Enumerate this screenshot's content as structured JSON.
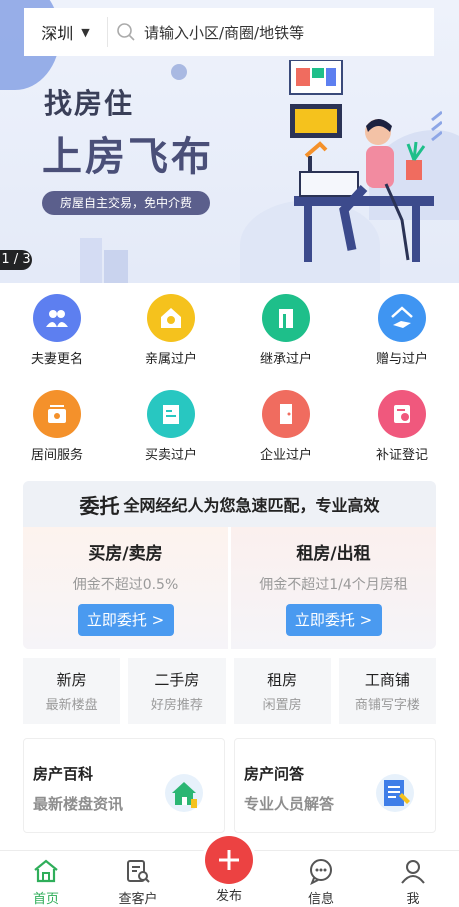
{
  "search": {
    "city": "深圳",
    "placeholder": "请输入小区/商圈/地铁等"
  },
  "banner": {
    "title_line1": "找房住",
    "title_line2": "上房飞布",
    "pill": "房屋自主交易，免中介费",
    "counter": "1 / 3"
  },
  "services": [
    {
      "label": "夫妻更名",
      "icon": "couple-icon",
      "color": "#5d7ff0"
    },
    {
      "label": "亲属过户",
      "icon": "house-key-icon",
      "color": "#f5c21d"
    },
    {
      "label": "继承过户",
      "icon": "building-icon",
      "color": "#1ebf8a"
    },
    {
      "label": "赠与过户",
      "icon": "gift-house-icon",
      "color": "#3f95f2"
    },
    {
      "label": "居间服务",
      "icon": "wallet-icon",
      "color": "#f4912b"
    },
    {
      "label": "买卖过户",
      "icon": "document-icon",
      "color": "#28c7c1"
    },
    {
      "label": "企业过户",
      "icon": "door-icon",
      "color": "#f06c5f"
    },
    {
      "label": "补证登记",
      "icon": "certificate-icon",
      "color": "#f0587d"
    }
  ],
  "delegation": {
    "head_big": "委托",
    "head_rest": "全网经纪人为您急速匹配，专业高效",
    "left": {
      "title": "买房/卖房",
      "sub": "佣金不超过0.5%",
      "button": "立即委托 >"
    },
    "right": {
      "title": "租房/出租",
      "sub": "佣金不超过1/4个月房租",
      "button": "立即委托 >"
    },
    "accent": "#4a9af0"
  },
  "categories": [
    {
      "title": "新房",
      "sub": "最新楼盘"
    },
    {
      "title": "二手房",
      "sub": "好房推荐"
    },
    {
      "title": "租房",
      "sub": "闲置房"
    },
    {
      "title": "工商铺",
      "sub": "商铺写字楼"
    }
  ],
  "info_cards": [
    {
      "title": "房产百科",
      "sub": "最新楼盘资讯",
      "icon": "house-book-icon"
    },
    {
      "title": "房产问答",
      "sub": "专业人员解答",
      "icon": "notepad-icon"
    }
  ],
  "tabbar": {
    "home": "首页",
    "clients": "查客户",
    "publish": "发布",
    "messages": "信息",
    "me": "我",
    "active_color": "#2fae5a",
    "publish_color": "#ec4242"
  }
}
